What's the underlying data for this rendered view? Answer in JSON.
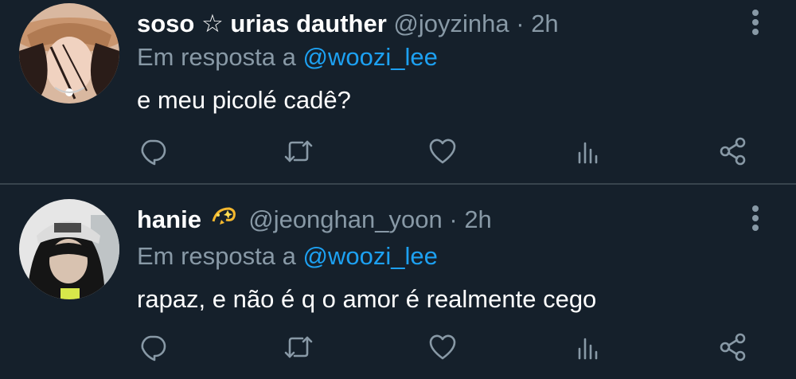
{
  "colors": {
    "background": "#15202b",
    "divider": "#38444d",
    "secondary_text": "#8899a6",
    "link": "#1da1f2",
    "primary_text": "#ffffff"
  },
  "tweets": [
    {
      "display_name": "soso ☆ urias dauther",
      "handle": "@joyzinha",
      "separator": "·",
      "time": "2h",
      "reply_prefix": "Em resposta a",
      "reply_to": "@woozi_lee",
      "text": "e meu picolé cadê?",
      "actions": [
        "reply-icon",
        "retweet-icon",
        "like-icon",
        "stats-icon",
        "share-icon"
      ]
    },
    {
      "display_name": "hanie",
      "name_emoji": "dizzy-emoji",
      "handle": "@jeonghan_yoon",
      "separator": "·",
      "time": "2h",
      "reply_prefix": "Em resposta a",
      "reply_to": "@woozi_lee",
      "text": "rapaz, e não é q o amor é realmente cego",
      "actions": [
        "reply-icon",
        "retweet-icon",
        "like-icon",
        "stats-icon",
        "share-icon"
      ]
    }
  ]
}
